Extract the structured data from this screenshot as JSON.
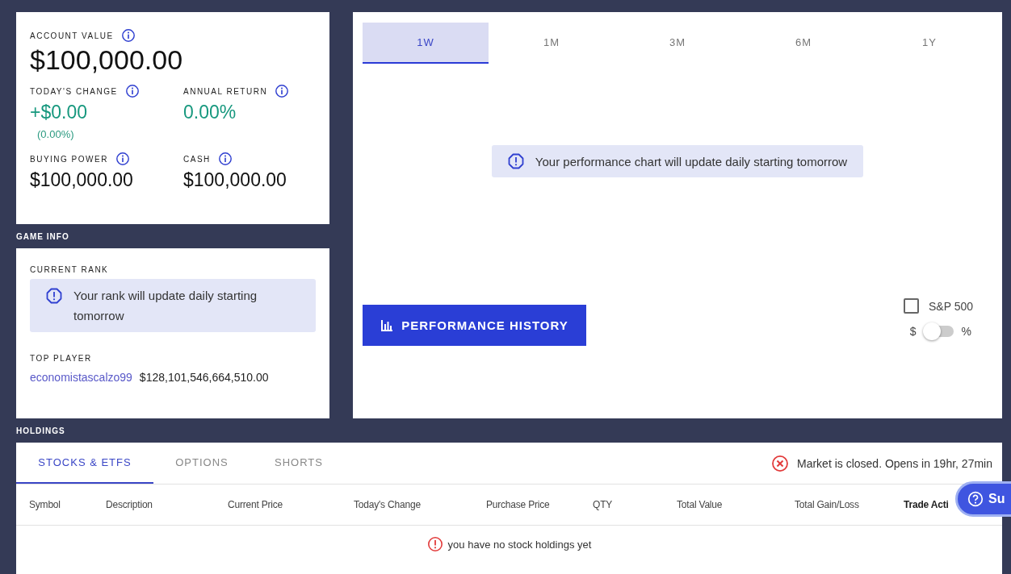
{
  "overview": {
    "account_value": {
      "label": "ACCOUNT VALUE",
      "value": "$100,000.00"
    },
    "stats": [
      {
        "label": "TODAY'S CHANGE",
        "value": "+$0.00",
        "sub": "(0.00%)",
        "kind": "gain"
      },
      {
        "label": "ANNUAL RETURN",
        "value": "0.00%",
        "kind": "gain"
      },
      {
        "label": "BUYING POWER",
        "value": "$100,000.00",
        "kind": "plain"
      },
      {
        "label": "CASH",
        "value": "$100,000.00",
        "kind": "plain"
      }
    ]
  },
  "game_info": {
    "title": "GAME INFO",
    "rank_label": "CURRENT RANK",
    "rank_notice": "Your rank will update daily starting tomorrow",
    "top_player_label": "TOP PLAYER",
    "top_player": "economistascalzo99",
    "top_player_value": "$128,101,546,664,510.00"
  },
  "performance": {
    "tabs": [
      {
        "label": "1W",
        "selected": true
      },
      {
        "label": "1M",
        "selected": false
      },
      {
        "label": "3M",
        "selected": false
      },
      {
        "label": "6M",
        "selected": false
      },
      {
        "label": "1Y",
        "selected": false
      }
    ],
    "notice": "Your performance chart will update daily starting tomorrow",
    "history_button": "PERFORMANCE HISTORY",
    "sp500": {
      "label": "S&P 500",
      "checked": false
    },
    "toggle": {
      "left": "$",
      "right": "%",
      "on": false
    }
  },
  "holdings": {
    "title": "HOLDINGS",
    "tabs": [
      {
        "label": "STOCKS & ETFS",
        "selected": true
      },
      {
        "label": "OPTIONS",
        "selected": false
      },
      {
        "label": "SHORTS",
        "selected": false
      }
    ],
    "market_status": "Market is closed. Opens in 19hr, 27min",
    "columns": [
      "Symbol",
      "Description",
      "Current Price",
      "Today's Change",
      "Purchase Price",
      "QTY",
      "Total Value",
      "Total Gain/Loss",
      "Trade Acti"
    ],
    "empty": "you have no stock holdings yet"
  },
  "support_button": "Su"
}
